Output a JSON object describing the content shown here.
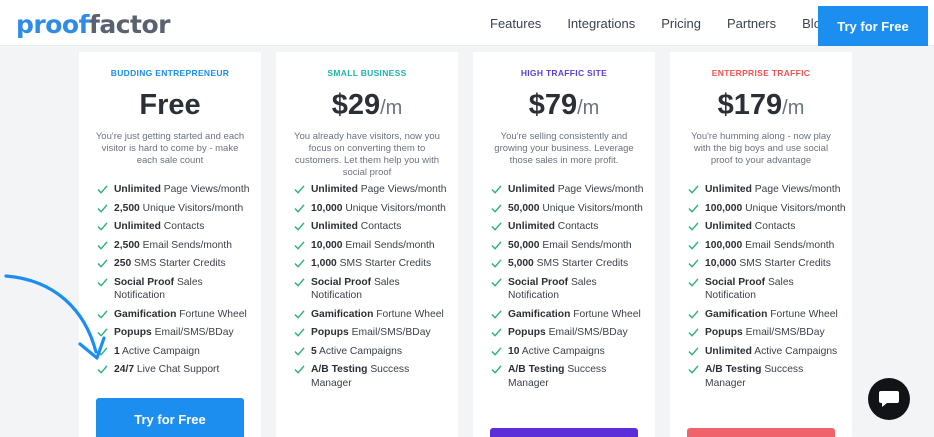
{
  "header": {
    "logo_part1": "proof",
    "logo_part2": "factor",
    "nav": [
      "Features",
      "Integrations",
      "Pricing",
      "Partners",
      "Blog"
    ],
    "cta": "Try for Free"
  },
  "plans": [
    {
      "tier": "BUDDING ENTREPRENEUR",
      "tier_color": "#1b8ef0",
      "price": "Free",
      "per": "",
      "desc": "You're just getting started and each visitor is hard to come by - make each sale count",
      "features": [
        {
          "bold": "Unlimited",
          "rest": " Page Views/month"
        },
        {
          "bold": "2,500",
          "rest": " Unique Visitors/month"
        },
        {
          "bold": "Unlimited",
          "rest": " Contacts"
        },
        {
          "bold": "2,500",
          "rest": " Email Sends/month"
        },
        {
          "bold": "250",
          "rest": " SMS Starter Credits"
        },
        {
          "bold": "Social Proof",
          "rest": " Sales Notification"
        },
        {
          "bold": "Gamification",
          "rest": " Fortune Wheel"
        },
        {
          "bold": "Popups",
          "rest": " Email/SMS/BDay"
        },
        {
          "bold": "1",
          "rest": " Active Campaign"
        },
        {
          "bold": "24/7",
          "rest": " Live Chat Support"
        }
      ],
      "button": "Try for Free",
      "button_color": "#1b8ef0"
    },
    {
      "tier": "SMALL BUSINESS",
      "tier_color": "#1fb5a8",
      "price": "$29",
      "per": "/m",
      "desc": "You already have visitors, now you focus on converting them to customers. Let them help you with social proof",
      "features": [
        {
          "bold": "Unlimited",
          "rest": " Page Views/month"
        },
        {
          "bold": "10,000",
          "rest": " Unique Visitors/month"
        },
        {
          "bold": "Unlimited",
          "rest": " Contacts"
        },
        {
          "bold": "10,000",
          "rest": " Email Sends/month"
        },
        {
          "bold": "1,000",
          "rest": " SMS Starter Credits"
        },
        {
          "bold": "Social Proof",
          "rest": " Sales Notification"
        },
        {
          "bold": "Gamification",
          "rest": " Fortune Wheel"
        },
        {
          "bold": "Popups",
          "rest": " Email/SMS/BDay"
        },
        {
          "bold": "5",
          "rest": " Active Campaigns"
        },
        {
          "bold": "A/B Testing",
          "rest": " Success Manager"
        }
      ],
      "button": "",
      "button_color": ""
    },
    {
      "tier": "HIGH TRAFFIC SITE",
      "tier_color": "#5b3fd6",
      "price": "$79",
      "per": "/m",
      "desc": "You're selling consistently and growing your business. Leverage those sales in more profit.",
      "features": [
        {
          "bold": "Unlimited",
          "rest": " Page Views/month"
        },
        {
          "bold": "50,000",
          "rest": " Unique Visitors/month"
        },
        {
          "bold": "Unlimited",
          "rest": " Contacts"
        },
        {
          "bold": "50,000",
          "rest": " Email Sends/month"
        },
        {
          "bold": "5,000",
          "rest": " SMS Starter Credits"
        },
        {
          "bold": "Social Proof",
          "rest": " Sales Notification"
        },
        {
          "bold": "Gamification",
          "rest": " Fortune Wheel"
        },
        {
          "bold": "Popups",
          "rest": " Email/SMS/BDay"
        },
        {
          "bold": "10",
          "rest": " Active Campaigns"
        },
        {
          "bold": "A/B Testing",
          "rest": " Success Manager"
        }
      ],
      "button": "",
      "button_color": "#5b2ed9"
    },
    {
      "tier": "ENTERPRISE TRAFFIC",
      "tier_color": "#f05252",
      "price": "$179",
      "per": "/m",
      "desc": "You're humming along - now play with the big boys and use social proof to your advantage",
      "features": [
        {
          "bold": "Unlimited",
          "rest": " Page Views/month"
        },
        {
          "bold": "100,000",
          "rest": " Unique Visitors/month"
        },
        {
          "bold": "Unlimited",
          "rest": " Contacts"
        },
        {
          "bold": "100,000",
          "rest": " Email Sends/month"
        },
        {
          "bold": "10,000",
          "rest": " SMS Starter Credits"
        },
        {
          "bold": "Social Proof",
          "rest": " Sales Notification"
        },
        {
          "bold": "Gamification",
          "rest": " Fortune Wheel"
        },
        {
          "bold": "Popups",
          "rest": " Email/SMS/BDay"
        },
        {
          "bold": "Unlimited",
          "rest": " Active Campaigns"
        },
        {
          "bold": "A/B Testing",
          "rest": " Success Manager"
        }
      ],
      "button": "",
      "button_color": "#f0636b"
    }
  ],
  "colors": {
    "check": "#2db37a",
    "arrow": "#1b8ef0",
    "chat": "#111316"
  },
  "icons": {
    "check": "check-icon",
    "arrow": "curved-arrow-icon",
    "chat": "chat-bubble-icon"
  }
}
